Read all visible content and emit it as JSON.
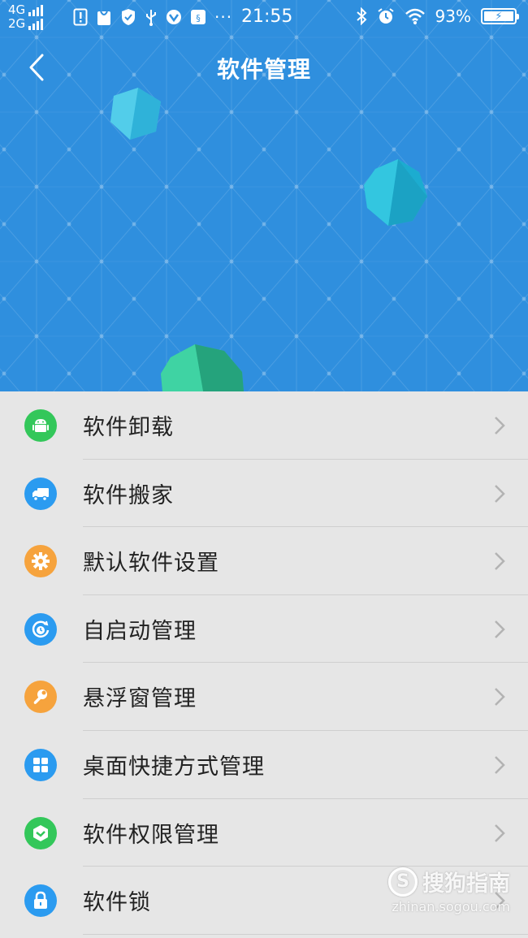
{
  "status_bar": {
    "network_top": "4G",
    "network_bottom": "2G",
    "time": "21:55",
    "more": "···",
    "battery": "93%",
    "icons": [
      "sim-alert-icon",
      "shopping-bag-icon",
      "shield-icon",
      "usb-icon",
      "vivo-icon",
      "usb-debug-icon",
      "bluetooth-icon",
      "alarm-icon",
      "wifi-icon",
      "battery-charging-icon"
    ]
  },
  "header": {
    "title": "软件管理",
    "back_icon": "chevron-left-icon"
  },
  "menu": {
    "items": [
      {
        "label": "软件卸载",
        "icon": "android-icon",
        "color": "#33c75a"
      },
      {
        "label": "软件搬家",
        "icon": "truck-icon",
        "color": "#2b9bf0"
      },
      {
        "label": "默认软件设置",
        "icon": "gear-icon",
        "color": "#f6a33d"
      },
      {
        "label": "自启动管理",
        "icon": "power-clock-icon",
        "color": "#2b9bf0"
      },
      {
        "label": "悬浮窗管理",
        "icon": "wrench-icon",
        "color": "#f6a33d"
      },
      {
        "label": "桌面快捷方式管理",
        "icon": "grid-icon",
        "color": "#2b9bf0"
      },
      {
        "label": "软件权限管理",
        "icon": "cube-icon",
        "color": "#33c75a"
      },
      {
        "label": "软件锁",
        "icon": "lock-icon",
        "color": "#2b9bf0"
      }
    ]
  },
  "watermark": {
    "brand": "搜狗指南",
    "url": "zhinan.sogou.com"
  }
}
